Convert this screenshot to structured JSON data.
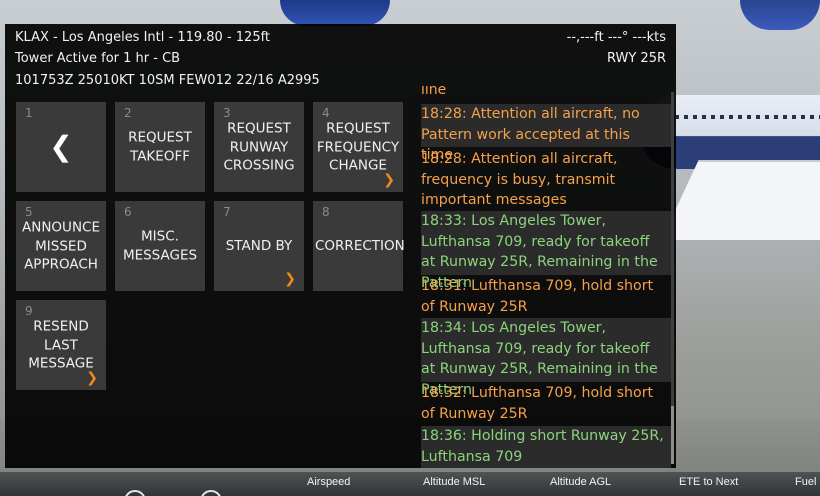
{
  "header": {
    "airport_line": "KLAX - Los Angeles Intl - 119.80 - 125ft",
    "status_line": "Tower Active for 1 hr - CB",
    "metar_line": "101753Z 25010KT 10SM FEW012 22/16 A2995",
    "altitude_speed": "--,---ft  ---° ---kts",
    "runway": "RWY 25R"
  },
  "buttons": [
    {
      "num": "1",
      "label": "",
      "icon": "chevron-left-icon"
    },
    {
      "num": "2",
      "label": "REQUEST TAKEOFF"
    },
    {
      "num": "3",
      "label": "REQUEST RUNWAY CROSSING"
    },
    {
      "num": "4",
      "label": "REQUEST FREQUENCY CHANGE",
      "icon": "chevron-right-icon"
    },
    {
      "num": "5",
      "label": "ANNOUNCE MISSED APPROACH"
    },
    {
      "num": "6",
      "label": "MISC. MESSAGES"
    },
    {
      "num": "7",
      "label": "STAND BY",
      "icon": "chevron-right-icon"
    },
    {
      "num": "8",
      "label": "CORRECTION"
    },
    {
      "num": "9",
      "label": "RESEND LAST MESSAGE",
      "icon": "chevron-right-icon"
    }
  ],
  "log": {
    "clipped_top": "line",
    "messages": [
      {
        "text": "18:28: Attention all aircraft, no Pattern work accepted at this time",
        "source": "tower",
        "shade": "dark"
      },
      {
        "text": "18:28: Attention all aircraft, frequency is busy, transmit important messages",
        "source": "tower",
        "shade": "none"
      },
      {
        "text": "18:33: Los Angeles Tower, Lufthansa 709, ready for takeoff at Runway 25R, Remaining in the Pattern",
        "source": "pilot",
        "shade": "dark"
      },
      {
        "text": "18:31: Lufthansa 709, hold short of Runway 25R",
        "source": "tower",
        "shade": "none"
      },
      {
        "text": "18:34: Los Angeles Tower, Lufthansa 709, ready for takeoff at Runway 25R, Remaining in the Pattern",
        "source": "pilot",
        "shade": "dark"
      },
      {
        "text": "18:32: Lufthansa 709, hold short of Runway 25R",
        "source": "tower",
        "shade": "none"
      },
      {
        "text": "18:36: Holding short Runway 25R, Lufthansa 709",
        "source": "pilot",
        "shade": "dark"
      }
    ]
  },
  "instrument_strip": {
    "labels": [
      "Airspeed",
      "Altitude MSL",
      "Altitude AGL",
      "ETE to Next",
      "Fuel"
    ]
  },
  "colors": {
    "tower_text": "#f5a04a",
    "pilot_text": "#8cd47c",
    "accent_chevron": "#f08a1d",
    "button_bg": "#3a3a3a"
  }
}
